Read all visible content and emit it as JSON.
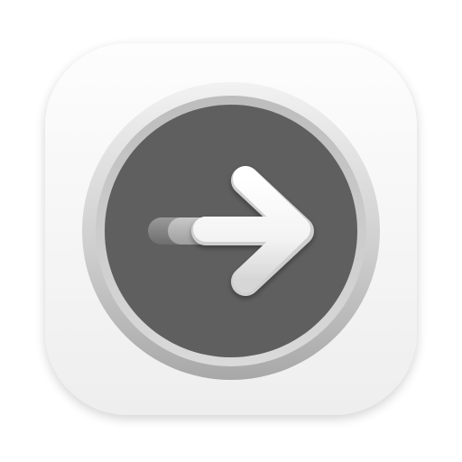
{
  "app_icon": {
    "icon": "arrow-right-icon",
    "colors": {
      "page_background": "#ffffff",
      "tile_light": "#fbfbfb",
      "tile_shade": "#e6e6e6",
      "rim_light": "#eeeeee",
      "rim_dark": "#a9a9a9",
      "button_face": "#5f5f5f",
      "arrow_highlight": "#ffffff",
      "arrow_shadow": "#c9c9c9",
      "trail_light": "#bdbdbd",
      "trail_dark": "#8a8a8a"
    }
  }
}
